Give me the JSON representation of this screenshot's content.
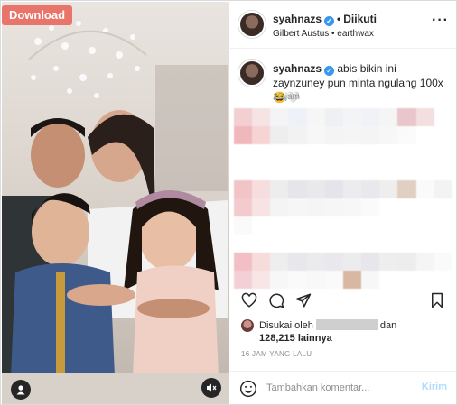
{
  "media": {
    "download_label": "Download",
    "user_tag_icon": "user-icon",
    "mute_icon": "speaker-muted-icon"
  },
  "header": {
    "username": "syahnazs",
    "separator": "•",
    "follow_label": "Diikuti",
    "audio_info": "Gilbert Austus • earthwax",
    "more_icon": "ellipsis-icon"
  },
  "caption": {
    "username": "syahnazs",
    "text": " abis bikin ini zaynzuney pun minta ngulang 100x 😂🤍",
    "time": "16 jam"
  },
  "actions": {
    "like_icon": "heart-icon",
    "comment_icon": "comment-icon",
    "share_icon": "send-icon",
    "save_icon": "bookmark-icon"
  },
  "likes": {
    "prefix": "Disukai oleh",
    "suffix": "dan",
    "count_text": "128,215 lainnya"
  },
  "posted_ago": "16 JAM YANG LALU",
  "comment_box": {
    "emoji_icon": "smiley-icon",
    "placeholder": "Tambahkan komentar...",
    "post_label": "Kirim"
  },
  "colors": {
    "verified": "#3897f0",
    "download_button": "#e8746a",
    "post_button_disabled": "#b3dbff"
  }
}
